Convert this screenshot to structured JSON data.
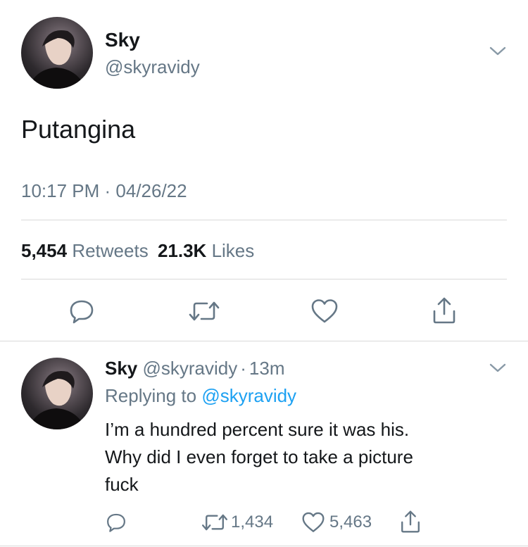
{
  "main_tweet": {
    "display_name": "Sky",
    "handle": "@skyravidy",
    "text": "Putangina",
    "timestamp": "10:17 PM · 04/26/22",
    "retweets_count": "5,454",
    "retweets_label": "Retweets",
    "likes_count": "21.3K",
    "likes_label": "Likes",
    "action_icons": [
      "reply-icon",
      "retweet-icon",
      "like-icon",
      "share-icon"
    ]
  },
  "reply": {
    "display_name": "Sky",
    "handle": "@skyravidy",
    "time_sep": "·",
    "time": "13m",
    "replying_to_label": "Replying to",
    "replying_to_handle": "@skyravidy",
    "text_lines": [
      "I’m a hundred percent sure it was his.",
      "Why did I even forget to take a picture",
      "fuck"
    ],
    "retweet_count": "1,434",
    "like_count": "5,463"
  },
  "colors": {
    "text": "#14171a",
    "muted": "#657786",
    "link": "#1da1f2",
    "divider": "#d9d9d9"
  }
}
